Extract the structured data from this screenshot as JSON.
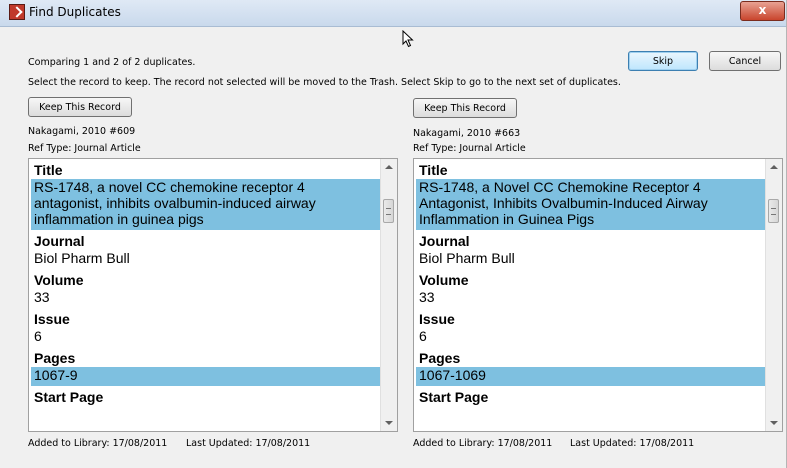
{
  "window": {
    "title": "Find Duplicates",
    "close_label": "x"
  },
  "header": {
    "comparing": "Comparing 1 and 2 of 2 duplicates.",
    "instructions": "Select the record to keep. The record not selected will be moved to the Trash. Select Skip to go to the next set of duplicates.",
    "skip_label": "Skip",
    "cancel_label": "Cancel"
  },
  "records": [
    {
      "keep_label": "Keep This Record",
      "ref_id": "Nakagami, 2010 #609",
      "ref_type": "Ref Type: Journal Article",
      "fields": [
        {
          "label": "Title",
          "value": "RS-1748, a novel CC chemokine receptor 4 antagonist, inhibits ovalbumin-induced airway inflammation in guinea pigs",
          "highlighted": true
        },
        {
          "label": "Journal",
          "value": "Biol Pharm Bull",
          "highlighted": false
        },
        {
          "label": "Volume",
          "value": "33",
          "highlighted": false
        },
        {
          "label": "Issue",
          "value": "6",
          "highlighted": false
        },
        {
          "label": "Pages",
          "value": "1067-9",
          "highlighted": true
        },
        {
          "label": "Start Page",
          "value": "",
          "highlighted": false
        }
      ],
      "added": "Added to Library: 17/08/2011",
      "updated": "Last Updated: 17/08/2011"
    },
    {
      "keep_label": "Keep This Record",
      "ref_id": "Nakagami, 2010 #663",
      "ref_type": "Ref Type: Journal Article",
      "fields": [
        {
          "label": "Title",
          "value": "RS-1748, a Novel CC Chemokine Receptor 4 Antagonist, Inhibits Ovalbumin-Induced Airway Inflammation in Guinea Pigs",
          "highlighted": true
        },
        {
          "label": "Journal",
          "value": "Biol Pharm Bull",
          "highlighted": false
        },
        {
          "label": "Volume",
          "value": "33",
          "highlighted": false
        },
        {
          "label": "Issue",
          "value": "6",
          "highlighted": false
        },
        {
          "label": "Pages",
          "value": "1067-1069",
          "highlighted": true
        },
        {
          "label": "Start Page",
          "value": "",
          "highlighted": false
        }
      ],
      "added": "Added to Library: 17/08/2011",
      "updated": "Last Updated: 17/08/2011"
    }
  ],
  "colors": {
    "highlight": "#7ec0e0",
    "close_button": "#c9452d"
  }
}
